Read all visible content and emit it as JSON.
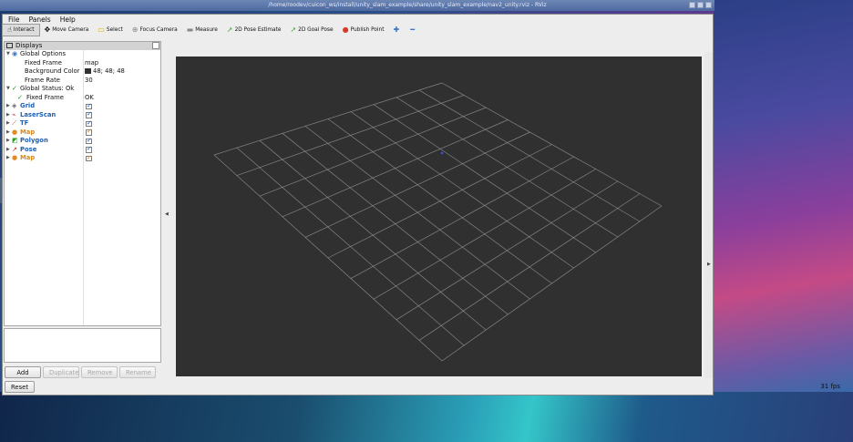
{
  "window": {
    "title": "/home/roodev/cuicon_ws/install/unity_slam_example/share/unity_slam_example/nav2_unity.rviz - RViz"
  },
  "menu": {
    "file": "File",
    "panels": "Panels",
    "help": "Help"
  },
  "toolbar": {
    "interact": "Interact",
    "move_camera": "Move Camera",
    "select": "Select",
    "focus_camera": "Focus Camera",
    "measure": "Measure",
    "pose_estimate": "2D Pose Estimate",
    "goal_pose": "2D Goal Pose",
    "publish_point": "Publish Point"
  },
  "displays": {
    "title": "Displays",
    "global_options": "Global Options",
    "fixed_frame_label": "Fixed Frame",
    "fixed_frame_value": "map",
    "bg_color_label": "Background Color",
    "bg_color_value": "48; 48; 48",
    "frame_rate_label": "Frame Rate",
    "frame_rate_value": "30",
    "global_status": "Global Status: Ok",
    "status_fixed_frame": "Fixed Frame",
    "status_fixed_frame_value": "OK",
    "items": [
      {
        "label": "Grid",
        "color": "#1d5fb5"
      },
      {
        "label": "LaserScan",
        "color": "#1d5fb5"
      },
      {
        "label": "TF",
        "color": "#1d5fb5"
      },
      {
        "label": "Map",
        "color": "#d8891a"
      },
      {
        "label": "Polygon",
        "color": "#1d5fb5"
      },
      {
        "label": "Pose",
        "color": "#1d5fb5"
      },
      {
        "label": "Map",
        "color": "#d8891a"
      }
    ]
  },
  "buttons": {
    "add": "Add",
    "duplicate": "Duplicate",
    "remove": "Remove",
    "rename": "Rename",
    "reset": "Reset"
  },
  "status": {
    "fps": "31 fps"
  },
  "colors": {
    "viewport_bg": "#303030",
    "grid_line": "#a0a0a0"
  }
}
